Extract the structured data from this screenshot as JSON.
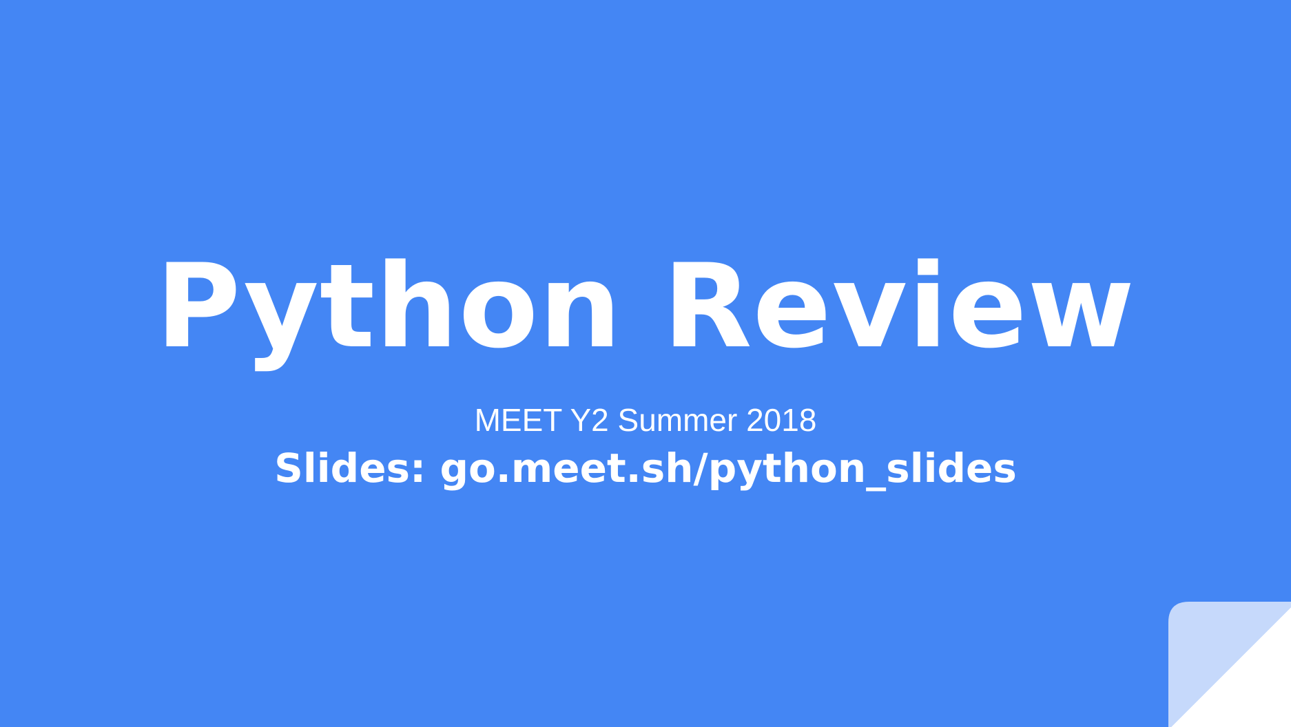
{
  "slide": {
    "title": "Python Review",
    "subtitle": "MEET Y2 Summer 2018",
    "slides_link": "Slides: go.meet.sh/python_slides",
    "colors": {
      "background": "#4486f4",
      "text": "#ffffff",
      "page_curl_fold": "#c6d9fb",
      "page_curl_corner": "#ffffff"
    },
    "decoration_icon": "page-curl-icon"
  }
}
